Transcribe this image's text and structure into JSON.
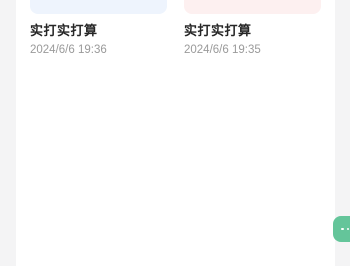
{
  "cards": [
    {
      "title": "实打实打算",
      "time": "2024/6/6 19:36",
      "thumb_color": "#eef4fd"
    },
    {
      "title": "实打实打算",
      "time": "2024/6/6 19:35",
      "thumb_color": "#fdf0f0"
    }
  ],
  "float_button": {
    "icon": "more-dots-icon",
    "color": "#64c59a"
  }
}
